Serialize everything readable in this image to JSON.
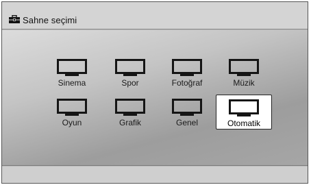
{
  "title": {
    "icon": "toolbox-icon",
    "text": "Sahne seçimi"
  },
  "scenes": [
    {
      "label": "Sinema",
      "icon": "tv-icon",
      "selected": false
    },
    {
      "label": "Spor",
      "icon": "tv-icon",
      "selected": false
    },
    {
      "label": "Fotoğraf",
      "icon": "tv-icon",
      "selected": false
    },
    {
      "label": "Müzik",
      "icon": "tv-icon",
      "selected": false
    },
    {
      "label": "Oyun",
      "icon": "tv-icon",
      "selected": false
    },
    {
      "label": "Grafik",
      "icon": "tv-icon",
      "selected": false
    },
    {
      "label": "Genel",
      "icon": "tv-icon",
      "selected": false
    },
    {
      "label": "Otomatik",
      "icon": "tv-icon",
      "selected": true
    }
  ]
}
